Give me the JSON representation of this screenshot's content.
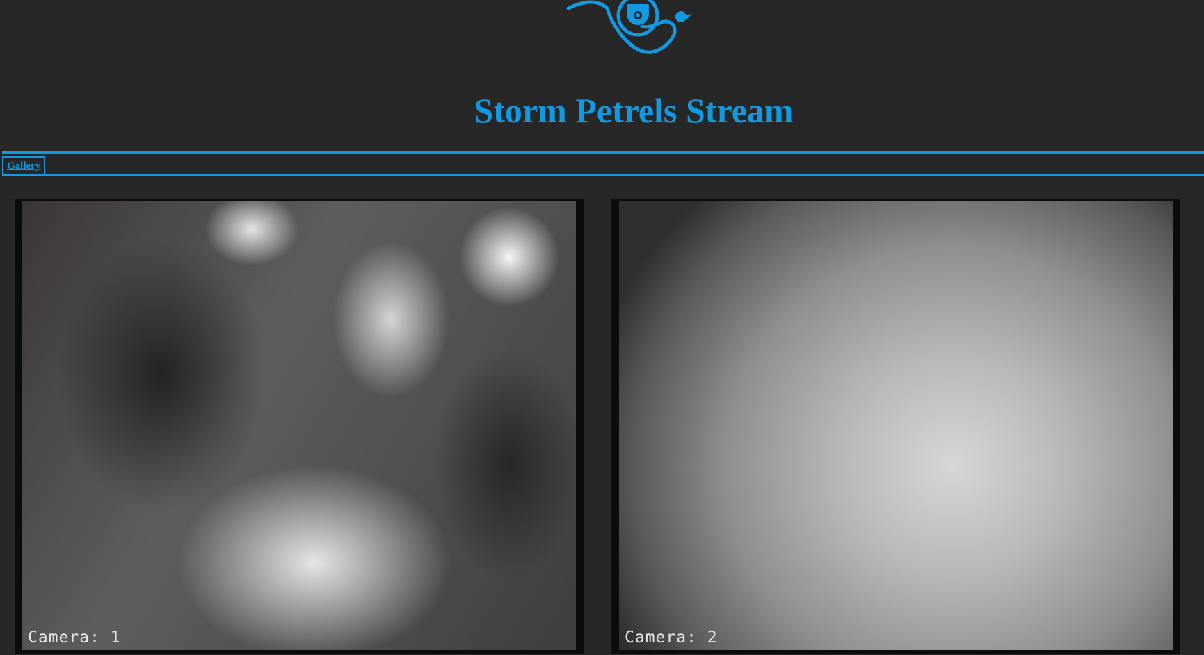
{
  "header": {
    "title": "Storm Petrels Stream",
    "logo_icon": "petrel-camera-logo-icon"
  },
  "nav": {
    "items": [
      {
        "label": "Gallery"
      }
    ]
  },
  "cameras": [
    {
      "label": "Camera: 1"
    },
    {
      "label": "Camera: 2"
    }
  ],
  "colors": {
    "accent": "#119ae2",
    "background": "#272727",
    "frame": "#0c0c0c"
  }
}
